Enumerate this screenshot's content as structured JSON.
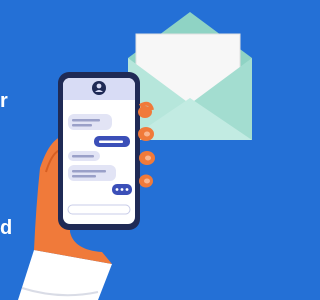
{
  "background_color": "#2470d6",
  "left_text_fragments": [
    "r",
    "d"
  ],
  "illustration": {
    "envelope": {
      "flap_color": "#8fd3c4",
      "body_color": "#aee1d5",
      "letter_color": "#f7f7f7"
    },
    "phone": {
      "frame_color": "#1f2a55",
      "screen_color": "#ffffff",
      "header_color": "#d8dcf5",
      "avatar_icon": "user-avatar-icon",
      "incoming_bubble_color": "#e2e4f5",
      "outgoing_bubble_color": "#3b4fb8",
      "typing_indicator": "ellipsis-icon"
    },
    "hand": {
      "skin_color": "#f07a3a",
      "sleeve_color": "#ffffff"
    }
  }
}
